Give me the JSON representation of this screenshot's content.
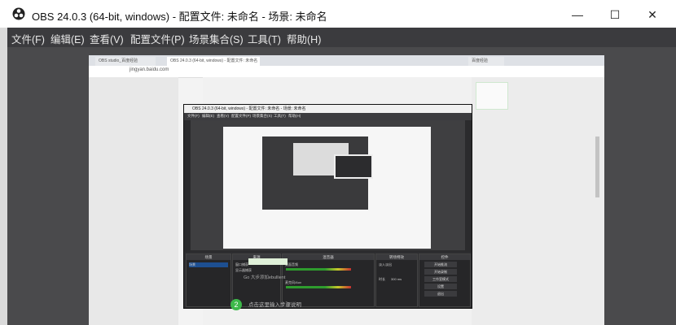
{
  "window": {
    "title": "OBS 24.0.3 (64-bit, windows) - 配置文件: 未命名 - 场景: 未命名",
    "minimize_symbol": "—",
    "maximize_symbol": "☐",
    "close_symbol": "✕"
  },
  "menu": {
    "items": [
      "文件(F)",
      "编辑(E)",
      "查看(V)",
      "配置文件(P)",
      "场景集合(S)",
      "工具(T)",
      "帮助(H)"
    ]
  },
  "browser": {
    "tab1": "OBS studio_百度经验",
    "tab2": "OBS 24.0.3 (64-bit, windows) - 配置文件: 未命名 - 场景: 未命名",
    "tab3": "百度经验",
    "address": "jingyan.baidu.com"
  },
  "nested_obs": {
    "title": "OBS 24.0.3 (64-bit, windows) - 配置文件: 未命名 - 场景: 未命名",
    "menu": [
      "文件(F)",
      "编辑(E)",
      "查看(V)",
      "配置文件(P)",
      "场景集合(S)",
      "工具(T)",
      "帮助(H)"
    ],
    "panels": {
      "scenes": "场景",
      "sources": "来源",
      "mixer": "混音器",
      "transitions": "转场特效",
      "controls": "控件"
    },
    "scene_item": "场景",
    "source_items": [
      "窗口捕获",
      "显示器捕获"
    ],
    "mixer_items": [
      "桌面音频",
      "麦克风/Aux"
    ],
    "controls": [
      "开始推流",
      "开始录制",
      "工作室模式",
      "设置",
      "退出"
    ],
    "transition_label": "淡入淡出",
    "duration_label": "时长",
    "duration_value": "300 ms"
  },
  "page": {
    "step_number": "2",
    "step_text": "点击这里输入步骤说明",
    "caption": "Go 大步添加ebullient"
  },
  "colors": {
    "menubar_bg": "#3b3b3e",
    "preview_bg": "#4a4a4c",
    "accent_green": "#3db94a"
  }
}
